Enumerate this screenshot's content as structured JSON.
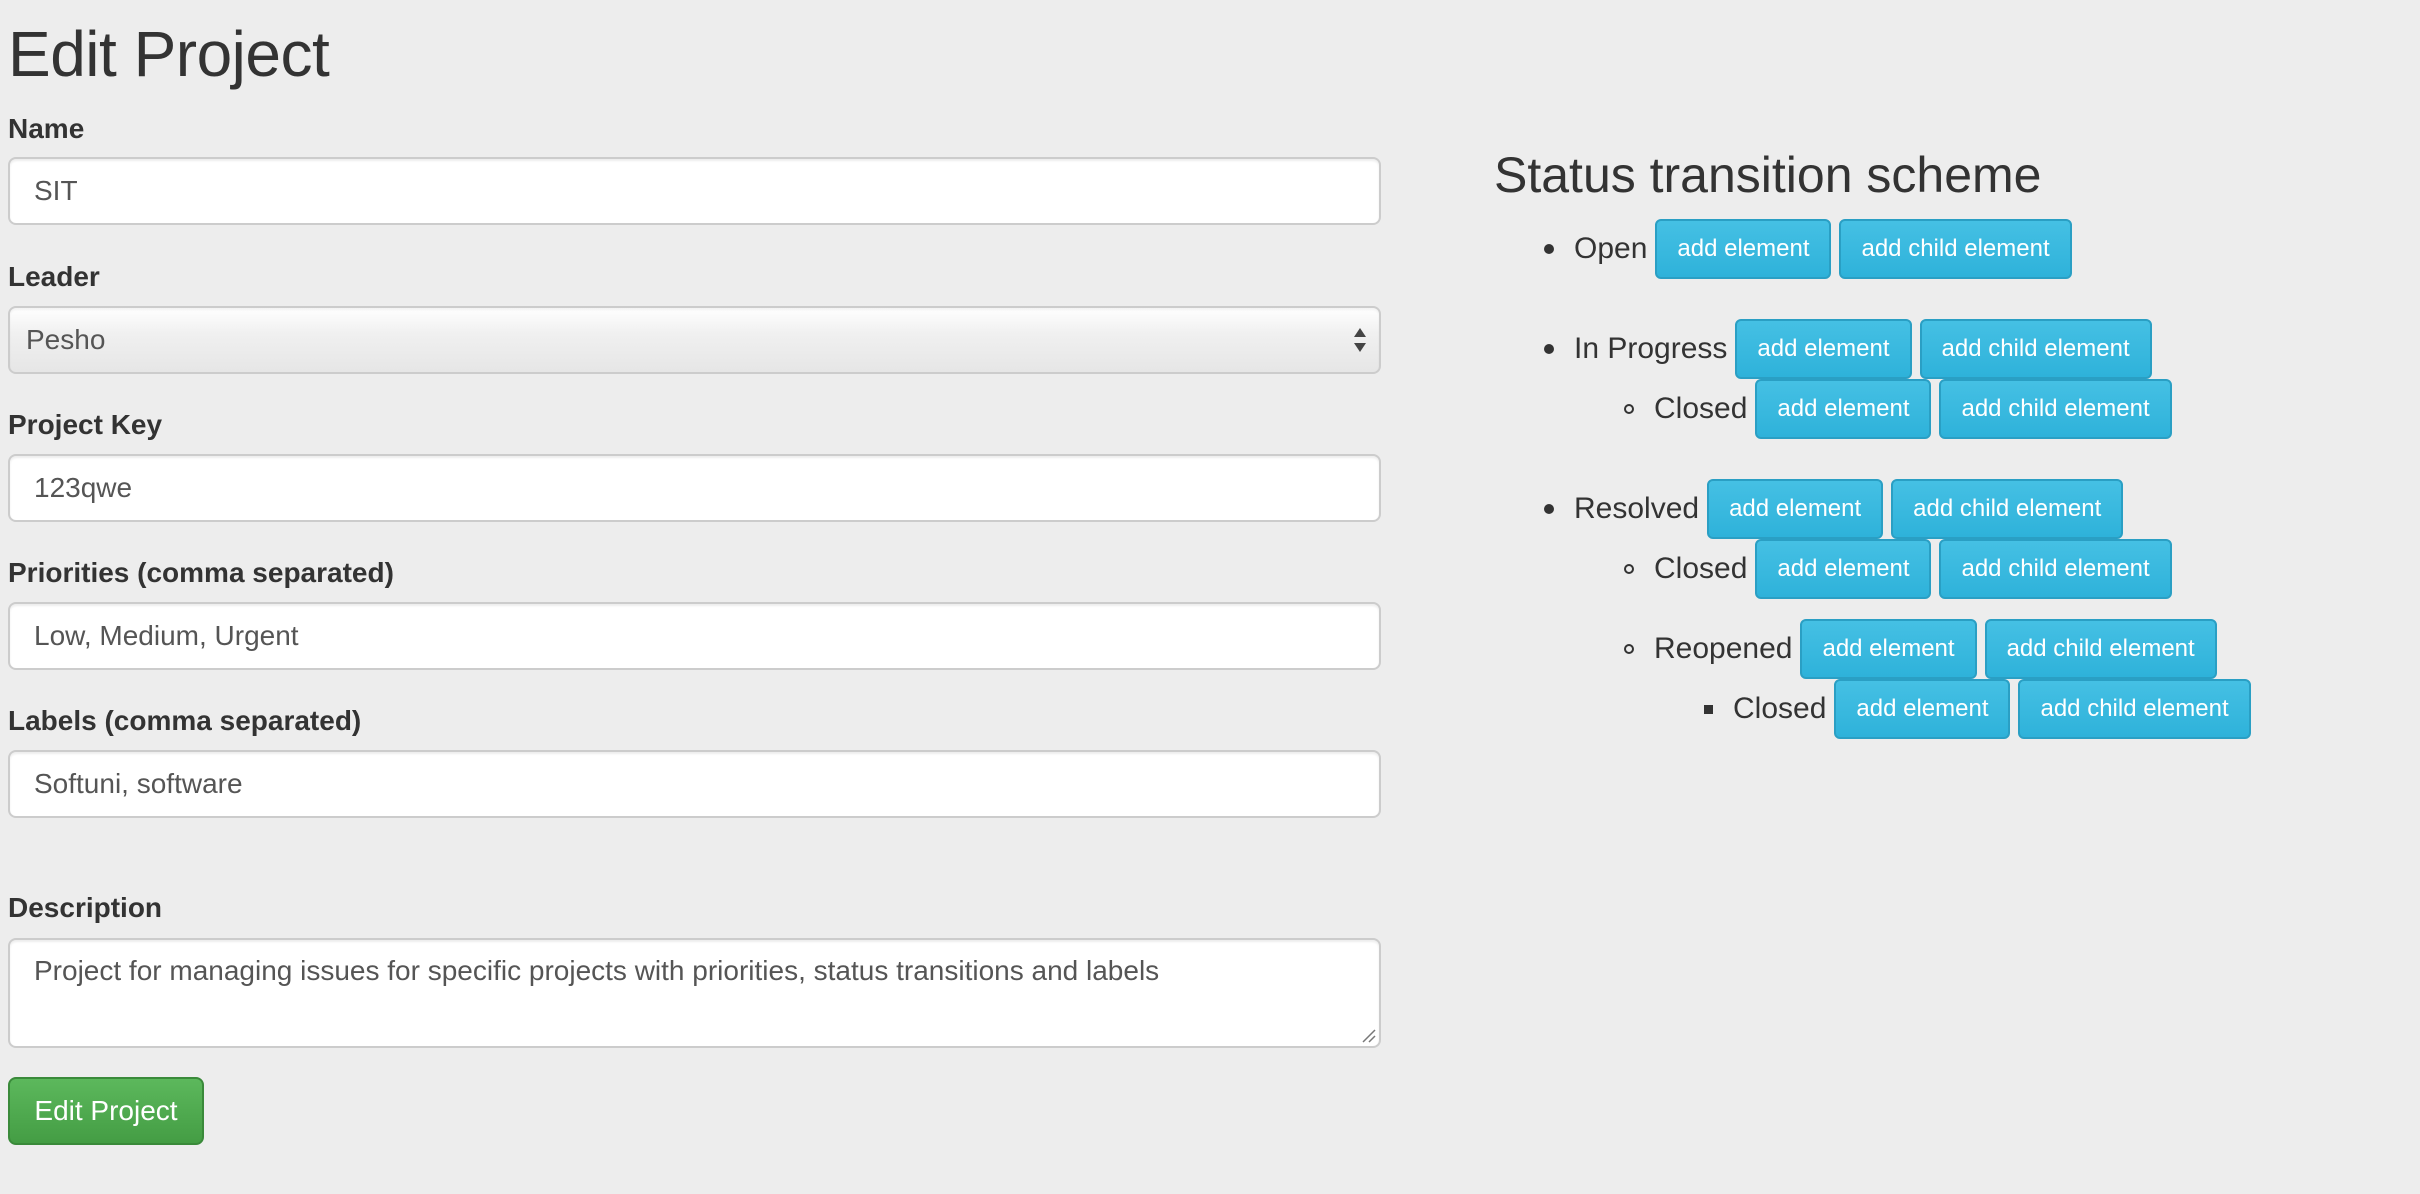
{
  "page": {
    "title": "Edit Project"
  },
  "form": {
    "name": {
      "label": "Name",
      "value": "SIT"
    },
    "leader": {
      "label": "Leader",
      "selected": "Pesho"
    },
    "project_key": {
      "label": "Project Key",
      "value": "123qwe"
    },
    "priorities": {
      "label": "Priorities (comma separated)",
      "value": "Low, Medium, Urgent"
    },
    "labels": {
      "label": "Labels (comma separated)",
      "value": "Softuni, software"
    },
    "description": {
      "label": "Description",
      "value": "Project for managing issues for specific projects with priorities, status transitions and labels"
    },
    "submit_label": "Edit Project"
  },
  "scheme": {
    "title": "Status transition scheme",
    "add_element_label": "add element",
    "add_child_element_label": "add child element",
    "statuses": [
      {
        "name": "Open",
        "level": 1
      },
      {
        "name": "In Progress",
        "level": 1
      },
      {
        "name": "Closed",
        "level": 2
      },
      {
        "name": "Resolved",
        "level": 1
      },
      {
        "name": "Closed",
        "level": 2
      },
      {
        "name": "Reopened",
        "level": 2
      },
      {
        "name": "Closed",
        "level": 3
      }
    ]
  },
  "colors": {
    "background": "#ededed",
    "primary_button": "#5cb85c",
    "info_button": "#31b0d5",
    "text": "#333333"
  }
}
